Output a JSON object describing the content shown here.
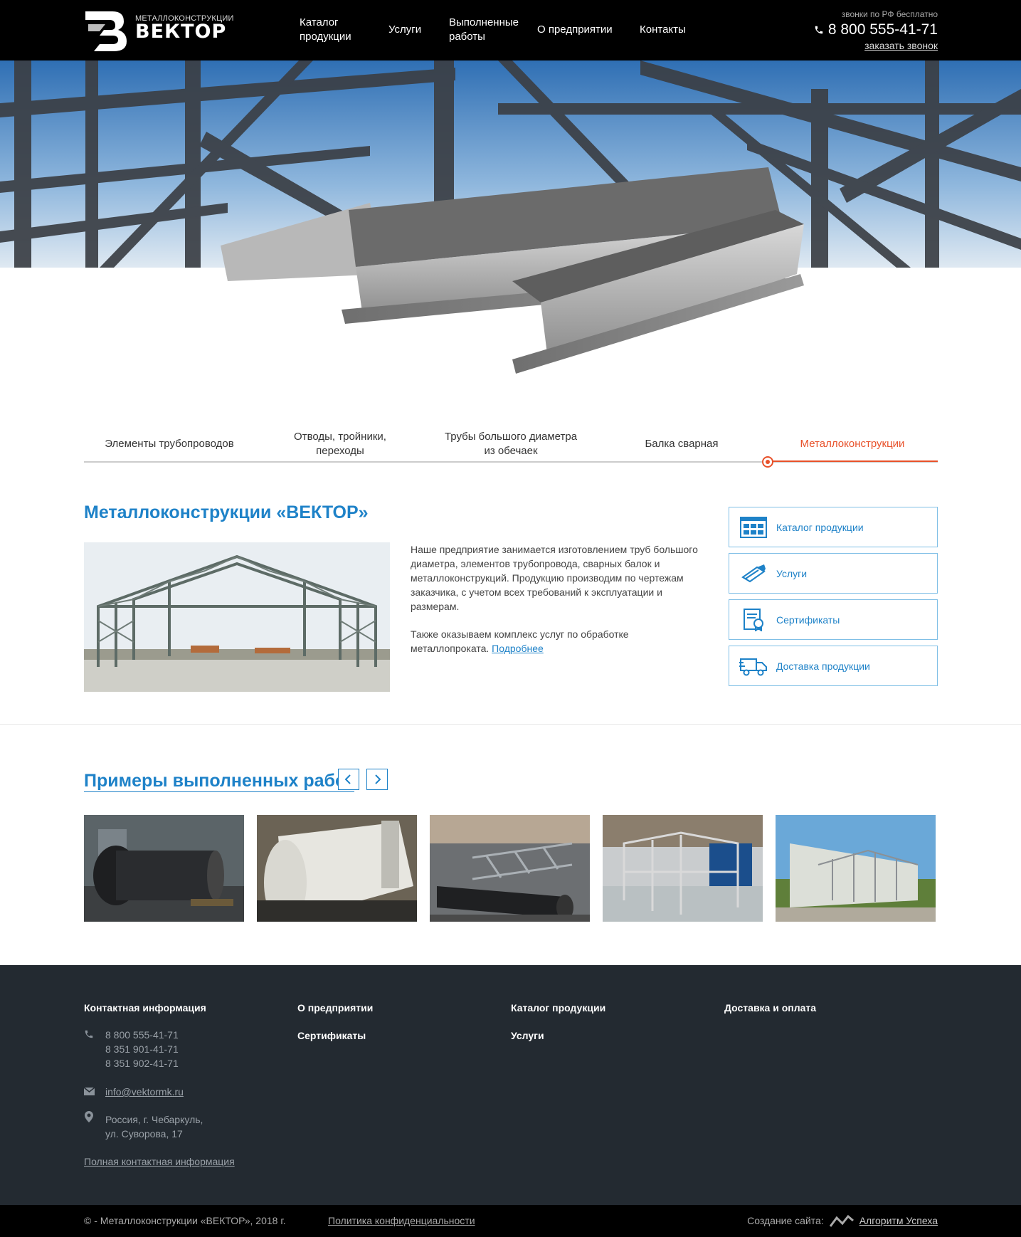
{
  "header": {
    "logo_small": "МЕТАЛЛОКОНСТРУКЦИИ",
    "logo_big": "ВЕКТОР",
    "nav": [
      "Каталог продукции",
      "Услуги",
      "Выполненные работы",
      "О предприятии",
      "Контакты"
    ],
    "free_calls": "звонки по РФ бесплатно",
    "phone": "8 800 555-41-71",
    "callback": "заказать звонок"
  },
  "tabs": {
    "items": [
      "Элементы трубопроводов",
      "Отводы, тройники, переходы",
      "Трубы большого диаметра из обечаек",
      "Балка сварная",
      "Металлоконструкции"
    ],
    "active_index": 4
  },
  "intro": {
    "title": "Металлоконструкции «ВЕКТОР»",
    "paragraph1": "Наше предприятие занимается изготовлением труб большого диаметра, элементов трубопровода, сварных балок и металлоконструкций. Продукцию производим по чертежам заказчика, с учетом всех требований к эксплуатации и размерам.",
    "paragraph2": "Также оказываем комплекс услуг по обработке металлопроката.",
    "more_link": "Подробнее"
  },
  "side_menu": [
    {
      "label": "Каталог продукции",
      "icon": "catalog-icon"
    },
    {
      "label": "Услуги",
      "icon": "services-icon"
    },
    {
      "label": "Сертификаты",
      "icon": "certificate-icon"
    },
    {
      "label": "Доставка продукции",
      "icon": "truck-icon"
    }
  ],
  "works": {
    "title": "Примеры выполненных работ"
  },
  "footer": {
    "contacts_title": "Контактная информация",
    "phones": [
      "8 800 555-41-71",
      "8 351 901-41-71",
      "8 351 902-41-71"
    ],
    "email": "info@vektormk.ru",
    "address": [
      "Россия, г. Чебаркуль,",
      "ул. Суворова, 17"
    ],
    "full_contacts": "Полная контактная информация",
    "col2": [
      "О предприятии",
      "Сертификаты"
    ],
    "col3": [
      "Каталог продукции",
      "Услуги"
    ],
    "col4": [
      "Доставка и оплата"
    ]
  },
  "bottom": {
    "copyright": "© - Металлоконструкции «ВЕКТОР», 2018 г.",
    "policy": "Политика конфиденциальности",
    "created_label": "Создание сайта:",
    "developer": "Алгоритм Успеха"
  },
  "colors": {
    "accent_blue": "#1e82c8",
    "accent_orange": "#e8512a",
    "footer_bg": "#232a31"
  }
}
